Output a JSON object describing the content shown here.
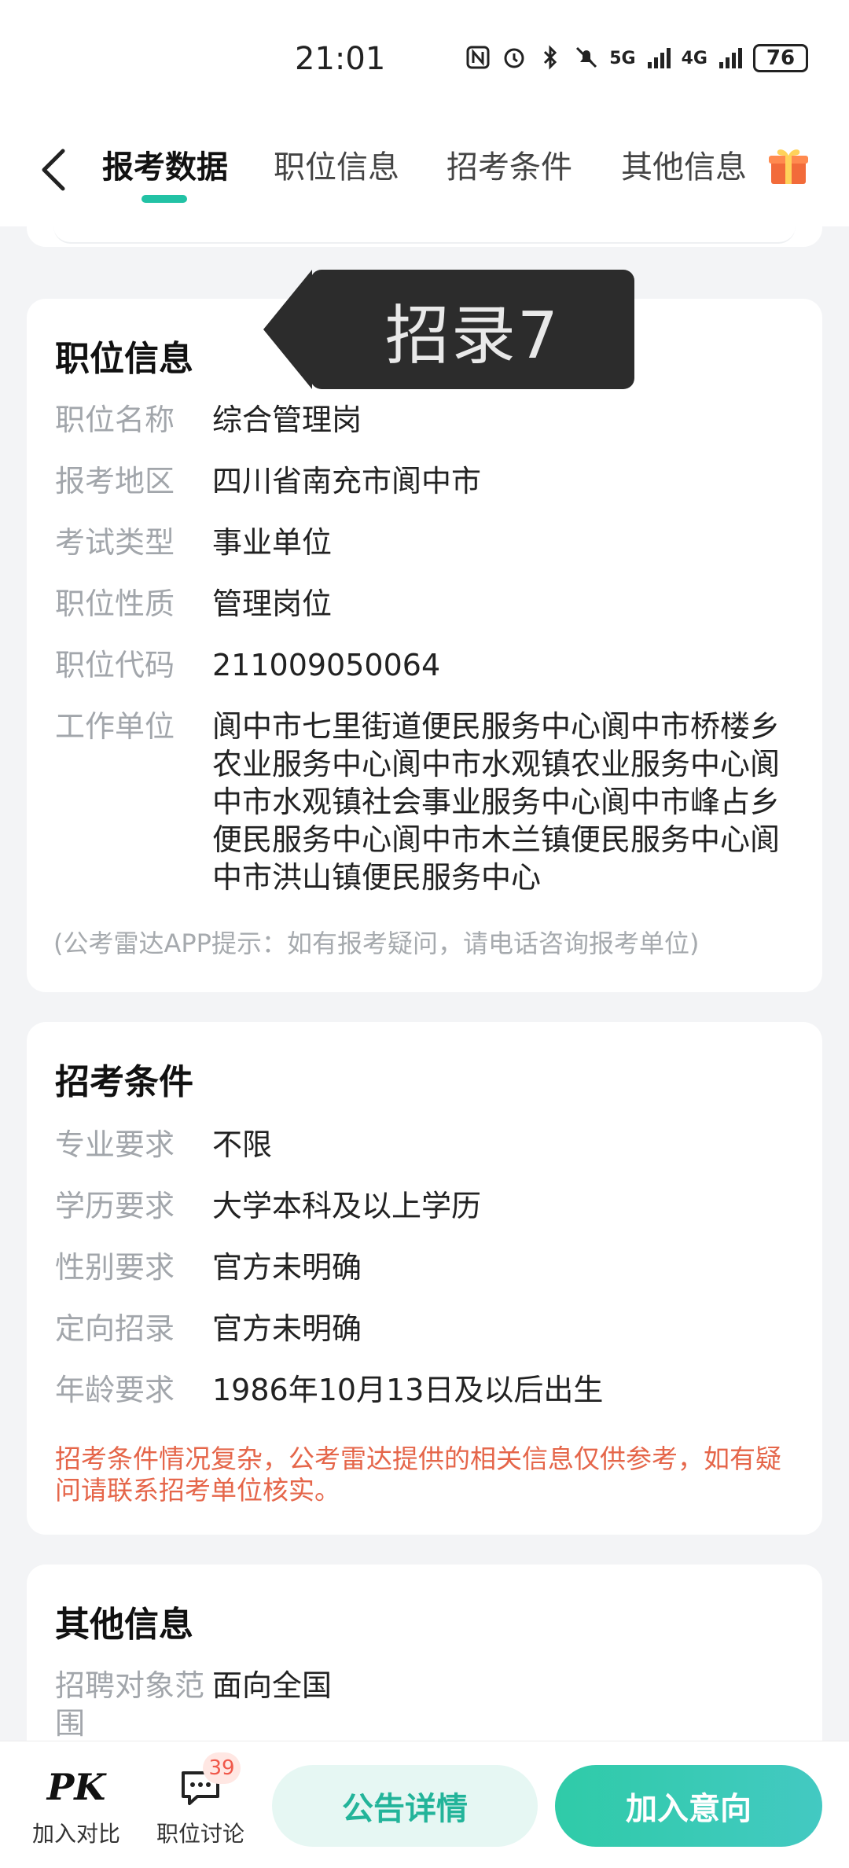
{
  "status_bar": {
    "time": "21:01",
    "network_5g": "5G",
    "network_4g": "4G",
    "battery": "76"
  },
  "nav": {
    "tabs": [
      {
        "label": "报考数据",
        "active": true
      },
      {
        "label": "职位信息",
        "active": false
      },
      {
        "label": "招考条件",
        "active": false
      },
      {
        "label": "其他信息",
        "active": false
      }
    ]
  },
  "overlay": {
    "text": "招录7"
  },
  "position_info": {
    "title": "职位信息",
    "rows": [
      {
        "label": "职位名称",
        "value": "综合管理岗"
      },
      {
        "label": "报考地区",
        "value": "四川省南充市阆中市"
      },
      {
        "label": "考试类型",
        "value": "事业单位"
      },
      {
        "label": "职位性质",
        "value": "管理岗位"
      },
      {
        "label": "职位代码",
        "value": "211009050064"
      },
      {
        "label": "工作单位",
        "value": "阆中市七里街道便民服务中心阆中市桥楼乡农业服务中心阆中市水观镇农业服务中心阆中市水观镇社会事业服务中心阆中市峰占乡便民服务中心阆中市木兰镇便民服务中心阆中市洪山镇便民服务中心"
      }
    ],
    "hint": "(公考雷达APP提示：如有报考疑问，请电话咨询报考单位)"
  },
  "conditions": {
    "title": "招考条件",
    "rows": [
      {
        "label": "专业要求",
        "value": "不限"
      },
      {
        "label": "学历要求",
        "value": "大学本科及以上学历"
      },
      {
        "label": "性别要求",
        "value": "官方未明确"
      },
      {
        "label": "定向招录",
        "value": "官方未明确"
      },
      {
        "label": "年龄要求",
        "value": "1986年10月13日及以后出生"
      }
    ],
    "warning": "招考条件情况复杂，公考雷达提供的相关信息仅供参考，如有疑问请联系招考单位核实。"
  },
  "other_info": {
    "title": "其他信息",
    "rows": [
      {
        "label": "招聘对象范围",
        "value": "面向全国"
      }
    ]
  },
  "bottom_bar": {
    "compare_icon": "PK",
    "compare_label": "加入对比",
    "discuss_label": "职位讨论",
    "discuss_badge": "39",
    "notice_button": "公告详情",
    "join_button": "加入意向"
  },
  "colors": {
    "accent": "#22c2a5",
    "warning": "#e5664a",
    "label_gray": "#a2a6ab"
  }
}
